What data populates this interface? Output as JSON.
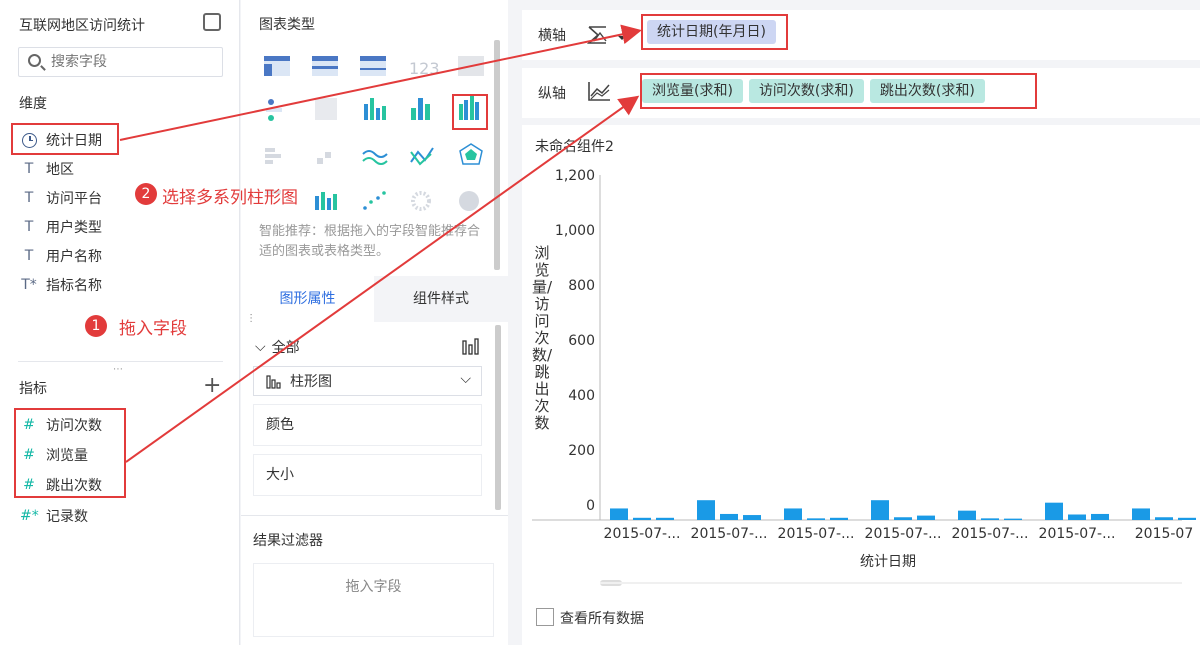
{
  "left_panel": {
    "title": "互联网地区访问统计",
    "search_placeholder": "搜索字段",
    "dimension_label": "维度",
    "dimensions": [
      {
        "label": "统计日期",
        "icon": "clock-icon"
      },
      {
        "label": "地区",
        "icon": "T"
      },
      {
        "label": "访问平台",
        "icon": "T"
      },
      {
        "label": "用户类型",
        "icon": "T"
      },
      {
        "label": "用户名称",
        "icon": "T"
      },
      {
        "label": "指标名称",
        "icon": "T*"
      }
    ],
    "measure_label": "指标",
    "measures": [
      {
        "label": "访问次数",
        "icon": "#"
      },
      {
        "label": "浏览量",
        "icon": "#"
      },
      {
        "label": "跳出次数",
        "icon": "#"
      },
      {
        "label": "记录数",
        "icon": "#*"
      }
    ]
  },
  "annotations": {
    "step1_num": "1",
    "step1_text": "拖入字段",
    "step2_num": "2",
    "step2_text": "选择多系列柱形图"
  },
  "middle_panel": {
    "chart_type_title": "图表类型",
    "hint": "智能推荐：根据拖入的字段智能推荐合适的图表或表格类型。",
    "tab_active": "图形属性",
    "tab_inactive": "组件样式",
    "all_label": "全部",
    "chart_select": "柱形图",
    "color_label": "颜色",
    "size_label": "大小",
    "filter_title": "结果过滤器",
    "filter_drop": "拖入字段"
  },
  "axes": {
    "x_label": "横轴",
    "x_field": "统计日期(年月日)",
    "y_label": "纵轴",
    "y_fields": [
      "浏览量(求和)",
      "访问次数(求和)",
      "跳出次数(求和)"
    ]
  },
  "chart": {
    "component_title": "未命名组件2",
    "view_all_label": "查看所有数据"
  },
  "chart_data": {
    "type": "bar",
    "xlabel": "统计日期",
    "ylabel": "浏览量/访问次数/跳出次数",
    "yticks": [
      "1,200",
      "1,000",
      "800",
      "600",
      "400",
      "200",
      "0"
    ],
    "ylim": [
      0,
      1200
    ],
    "categories": [
      "2015-07-...",
      "2015-07-...",
      "2015-07-...",
      "2015-07-...",
      "2015-07-...",
      "2015-07-...",
      "2015-07"
    ],
    "series": [
      {
        "values": [
          42,
          72,
          42,
          72,
          34,
          63,
          42
        ]
      },
      {
        "values": [
          8,
          22,
          6,
          10,
          6,
          20,
          10
        ]
      },
      {
        "values": [
          8,
          18,
          8,
          16,
          5,
          22,
          8
        ]
      }
    ],
    "color": "#1a9ae6",
    "grid": false
  }
}
